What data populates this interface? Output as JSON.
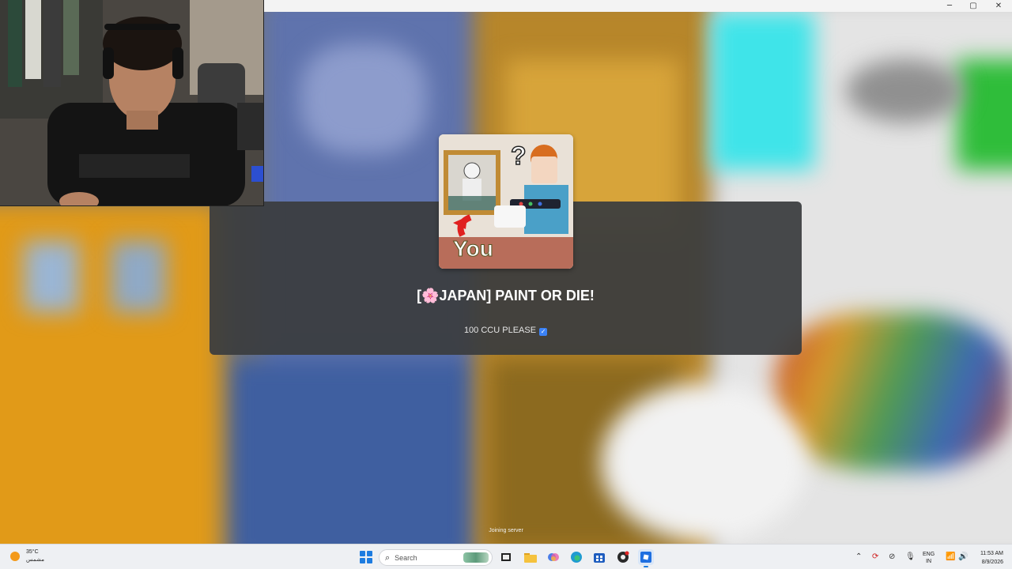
{
  "game": {
    "name": "[🌸JAPAN] PAINT OR DIE!",
    "creator_note": "100 CCU PLEASE",
    "status": "Joining server",
    "thumbnail_caption": "You",
    "thumbnail_question": "?"
  },
  "window_controls": {
    "minimize": "─",
    "maximize": "▢",
    "close": "✕"
  },
  "taskbar": {
    "weather": {
      "temperature": "35°C",
      "condition": "مشمس",
      "icon": "sun-icon"
    },
    "search_placeholder": "Search",
    "apps": [
      {
        "name": "file-explorer-icon"
      },
      {
        "name": "task-view-icon"
      },
      {
        "name": "folder-icon"
      },
      {
        "name": "copilot-icon"
      },
      {
        "name": "edge-icon"
      },
      {
        "name": "store-icon"
      },
      {
        "name": "obs-icon"
      },
      {
        "name": "roblox-icon"
      }
    ],
    "tray": {
      "language_line1": "ENG",
      "language_line2": "IN",
      "time": "11:53 AM",
      "date": "8/9/2026"
    }
  },
  "colors": {
    "panel": "#3a3c3e",
    "taskbar": "#eef0f3",
    "accent": "#1d7ce0",
    "verified": "#3b82f6"
  }
}
